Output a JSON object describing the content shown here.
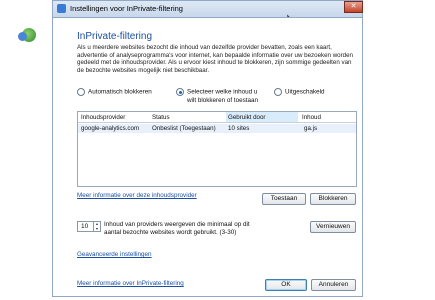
{
  "window": {
    "title": "Instellingen voor InPrivate-filtering",
    "close_glyph": "✕"
  },
  "header": {
    "heading": "InPrivate-filtering",
    "description": "Als u meerdere websites bezocht die inhoud van dezelfde provider bevatten, zoals een kaart, advertentie of analyseprogramma's voor internet, kan bepaalde informatie over uw bezoeken worden gedeeld met de inhoudsprovider. Als u ervoor kiest inhoud te blokkeren, zijn sommige gedeelten van de bezochte websites mogelijk niet beschikbaar."
  },
  "options": {
    "auto_block": "Automatisch blokkeren",
    "choose_line1": "Selecteer welke inhoud u",
    "choose_line2": "wilt blokkeren of toestaan",
    "disabled": "Uitgeschakeld",
    "selected": "choose"
  },
  "table": {
    "columns": [
      "Inhoudsprovider",
      "Status",
      "Gebruikt door",
      "Inhoud"
    ],
    "rows": [
      [
        "google-analytics.com",
        "Onbeslist (Toegestaan)",
        "10 sites",
        "ga.js"
      ]
    ]
  },
  "links": {
    "more_info_provider": "Meer informatie over deze inhoudsprovider",
    "advanced": "Geavanceerde instellingen",
    "more_info_filtering": "Meer informatie over InPrivate-filtering"
  },
  "buttons": {
    "allow": "Toestaan",
    "block": "Blokkeren",
    "refresh": "Vernieuwen",
    "ok": "OK",
    "cancel": "Annuleren"
  },
  "threshold": {
    "value": "10",
    "text": "Inhoud van providers weergeven die minimaal op dit aantal bezochte websites wordt gebruikt. (3-30)"
  },
  "icons": {
    "window_icon": "inprivate-icon",
    "header_icon": "inprivate-filtering-icon"
  }
}
